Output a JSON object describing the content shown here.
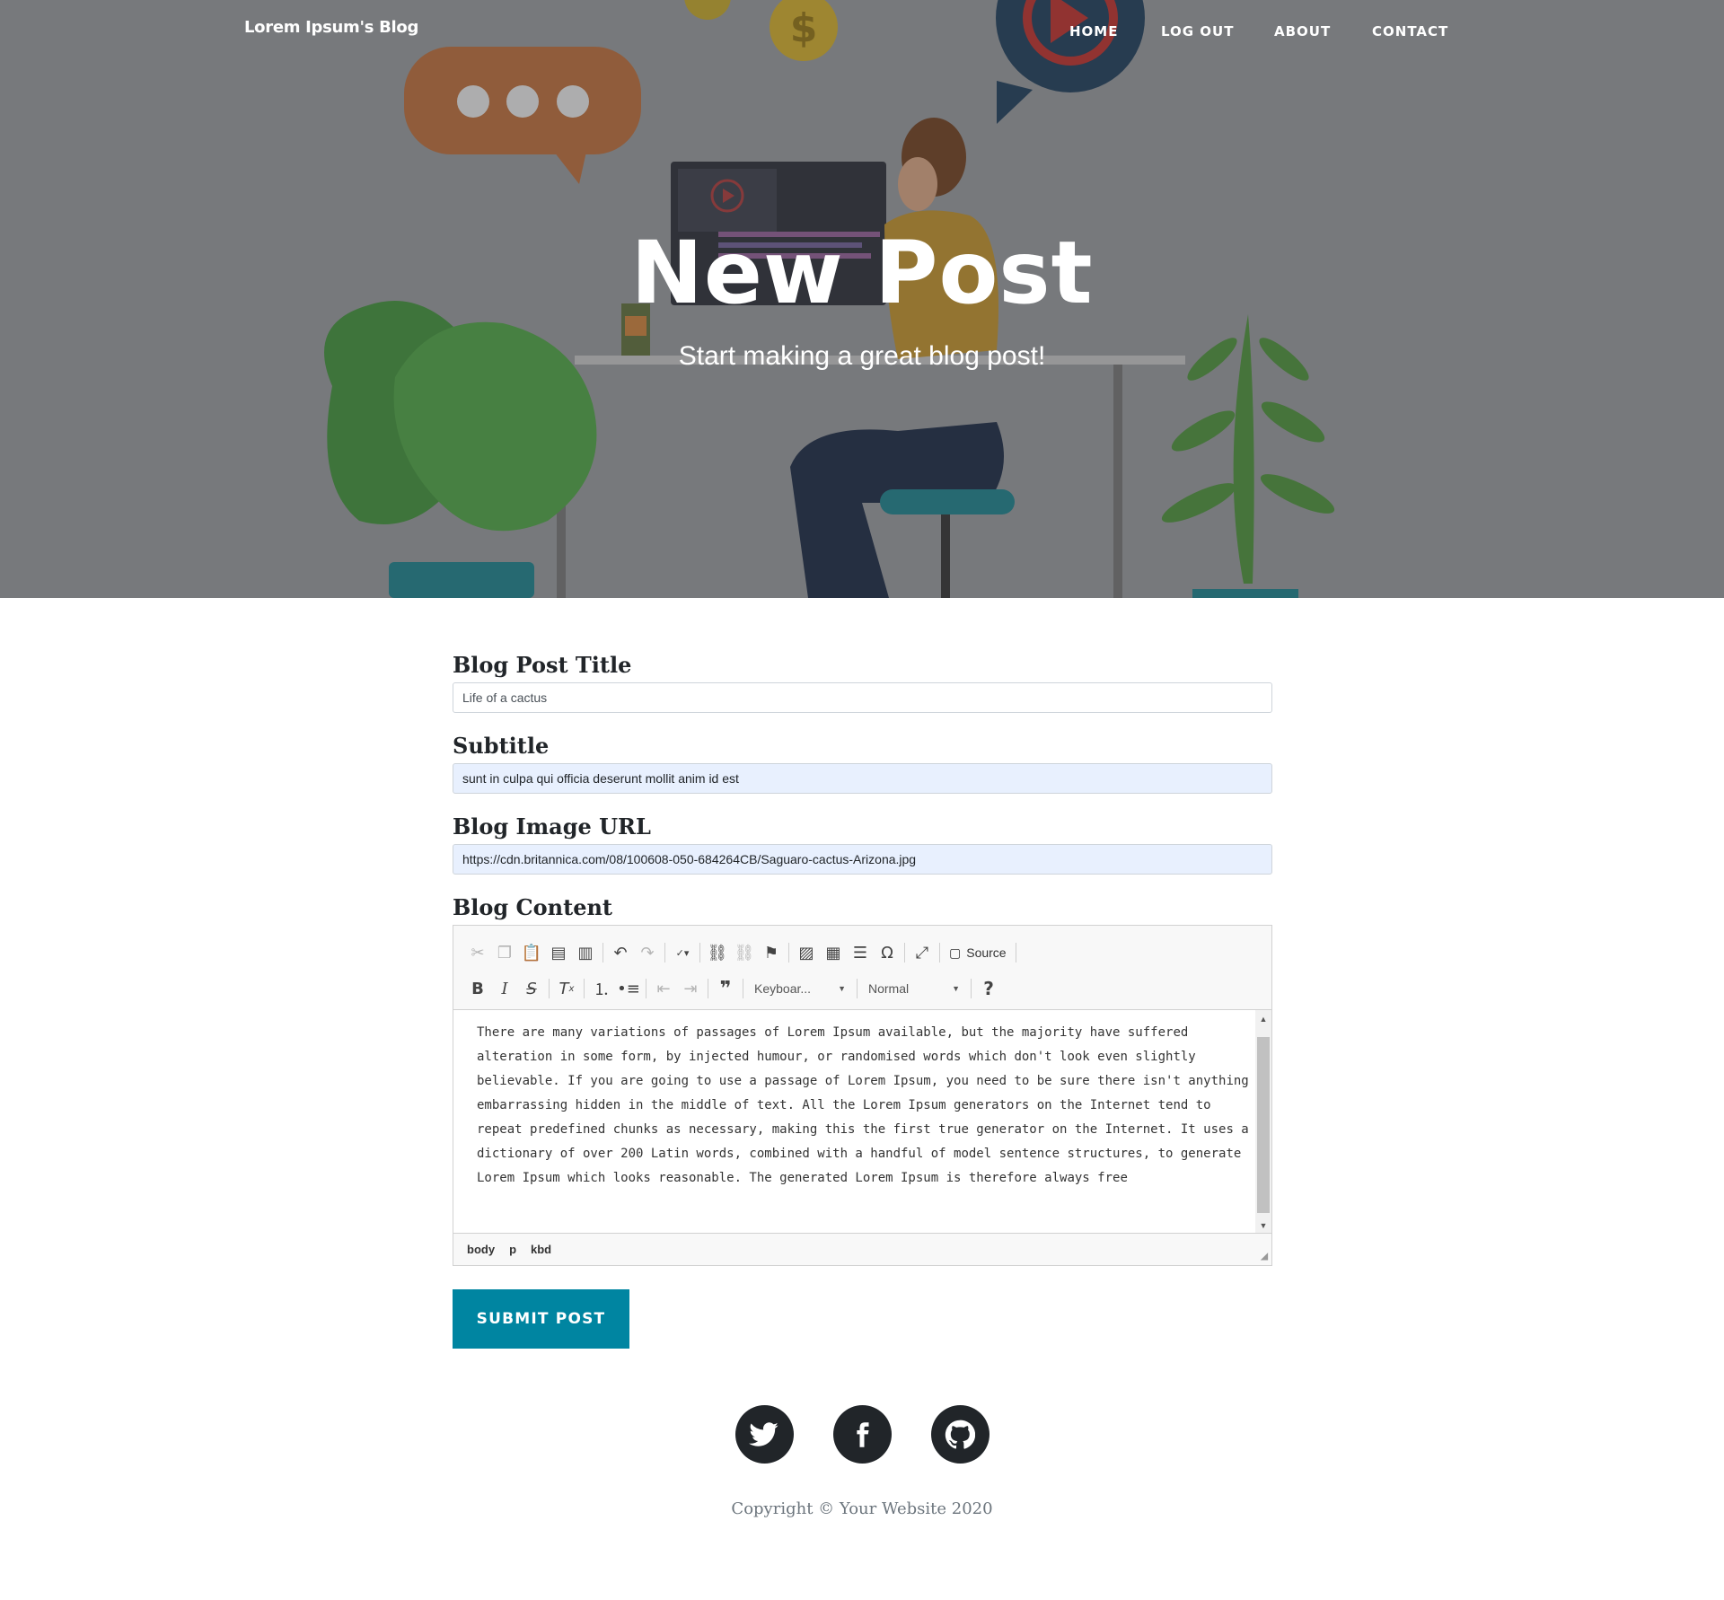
{
  "nav": {
    "brand": "Lorem Ipsum's Blog",
    "items": [
      {
        "label": "HOME"
      },
      {
        "label": "LOG OUT"
      },
      {
        "label": "ABOUT"
      },
      {
        "label": "CONTACT"
      }
    ]
  },
  "hero": {
    "title": "New Post",
    "subtitle": "Start making a great blog post!"
  },
  "form": {
    "title_label": "Blog Post Title",
    "title_value": "Life of a cactus",
    "subtitle_label": "Subtitle",
    "subtitle_value": "sunt in culpa qui officia deserunt mollit anim id est",
    "image_label": "Blog Image URL",
    "image_value": "https://cdn.britannica.com/08/100608-050-684264CB/Saguaro-cactus-Arizona.jpg",
    "content_label": "Blog Content",
    "submit_label": "SUBMIT POST"
  },
  "editor": {
    "source_label": "Source",
    "style_combo": "Keyboar...",
    "format_combo": "Normal",
    "help": "?",
    "content": "There are many variations of passages of Lorem Ipsum available, but the majority have suffered alteration in some form, by injected humour, or randomised words which don't look even slightly believable. If you are going to use a passage of Lorem Ipsum, you need to be sure there isn't anything embarrassing hidden in the middle of text. All the Lorem Ipsum generators on the Internet tend to repeat predefined chunks as necessary, making this the first true generator on the Internet. It uses a dictionary of over 200 Latin words, combined with a handful of model sentence structures, to generate Lorem Ipsum which looks reasonable. The generated Lorem Ipsum is therefore always free",
    "path": [
      "body",
      "p",
      "kbd"
    ]
  },
  "footer": {
    "copyright": "Copyright © Your Website 2020",
    "socials": [
      "twitter-icon",
      "facebook-icon",
      "github-icon"
    ]
  },
  "colors": {
    "accent": "#0085a1",
    "dark": "#212529",
    "hero_bg": "#8e9093"
  }
}
